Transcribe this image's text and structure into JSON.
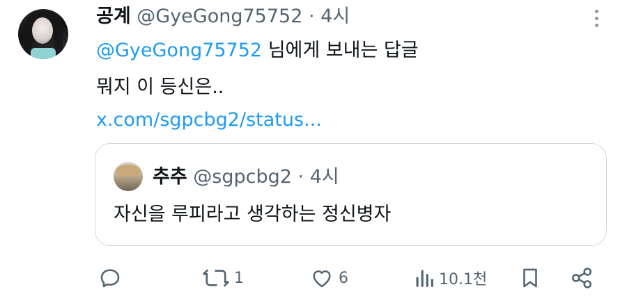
{
  "tweet": {
    "display_name": "공계",
    "handle": "@GyeGong75752",
    "separator": "·",
    "time": "4시",
    "reply_mention": "@GyeGong75752",
    "reply_suffix": " 님에게 보내는 답글",
    "text": "뭐지 이 등신은..",
    "link": "x.com/sgpcbg2/status..."
  },
  "quote": {
    "display_name": "추추",
    "handle": "@sgpcbg2",
    "separator": "·",
    "time": "4시",
    "text": "자신을 루피라고 생각하는 정신병자"
  },
  "actions": {
    "replies": "",
    "retweets": "1",
    "likes": "6",
    "views": "10.1천"
  },
  "colors": {
    "accent": "#1d9bf0",
    "secondary_text": "#536471",
    "border": "#cfd9de"
  },
  "icons": [
    "more-icon",
    "reply-icon",
    "retweet-icon",
    "like-icon",
    "views-icon",
    "bookmark-icon",
    "share-icon"
  ]
}
